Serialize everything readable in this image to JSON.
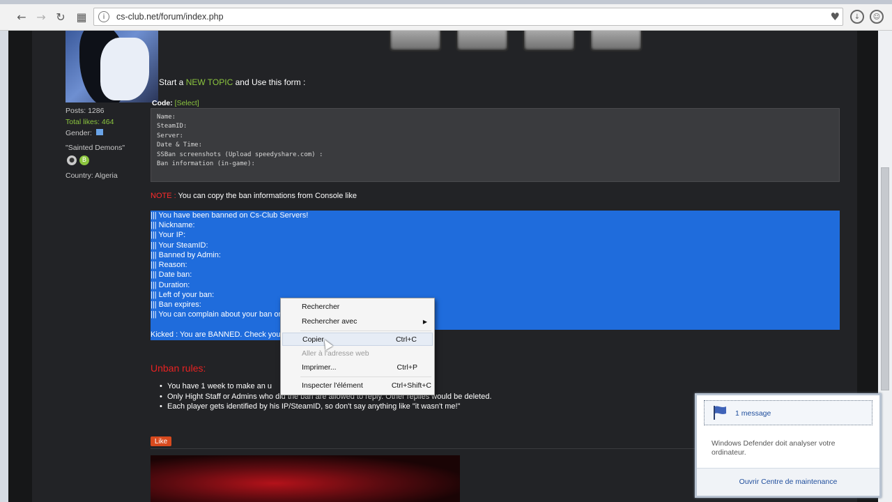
{
  "browser": {
    "url": "cs-club.net/forum/index.php"
  },
  "profile": {
    "posts": "Posts: 1286",
    "total_likes": "Total likes: 464",
    "gender": "Gender:",
    "signature": "\"Sainted Demons\"",
    "country": "Country: Algeria"
  },
  "post": {
    "intro_prefix": "Start a ",
    "intro_link": "NEW TOPIC",
    "intro_suffix": " and Use this form :",
    "code_label": "Code:",
    "code_select": "[Select]",
    "code_lines": [
      "Name:",
      "SteamID:",
      "Server:",
      "Date & Time:",
      "SSBan screenshots (Upload speedyshare.com) :",
      "",
      "Ban information (in-game):"
    ],
    "note_label": "NOTE :",
    "note_text": " You can copy the ban informations from Console like",
    "ban_lines": [
      "||| You have been banned on Cs-Club Servers!",
      "||| Nickname:",
      "||| Your IP:",
      "||| Your SteamID:",
      "||| Banned by Admin:",
      "||| Reason:",
      "||| Date ban:",
      "||| Duration:",
      "||| Left of your ban:",
      "||| Ban expires:",
      "||| You can complain about your ban on"
    ],
    "kicked_line": "Kicked : You are BANNED. Check your",
    "unban_title": "Unban rules:",
    "rules": [
      "You have 1 week to make an u",
      "Only Hight Staff or Admins who did the ban are allowed to reply. Other replies would be deleted.",
      "Each player gets identified by his IP/SteamID, so don't say anything like \"it wasn't me!\""
    ],
    "like_label": "Like"
  },
  "context_menu": {
    "items": [
      {
        "label": "Rechercher",
        "shortcut": "",
        "disabled": false
      },
      {
        "label": "Rechercher avec",
        "shortcut": "",
        "disabled": false,
        "submenu": true
      },
      {
        "label": "Copier",
        "shortcut": "Ctrl+C",
        "disabled": false,
        "highlighted": true
      },
      {
        "label": "Aller à l'adresse web",
        "shortcut": "",
        "disabled": true
      },
      {
        "label": "Imprimer...",
        "shortcut": "Ctrl+P",
        "disabled": false
      },
      {
        "label": "Inspecter l'élément",
        "shortcut": "Ctrl+Shift+C",
        "disabled": false
      }
    ]
  },
  "notification": {
    "title": "1 message",
    "body": "Windows Defender doit analyser votre ordinateur.",
    "link": "Ouvrir Centre de maintenance"
  }
}
